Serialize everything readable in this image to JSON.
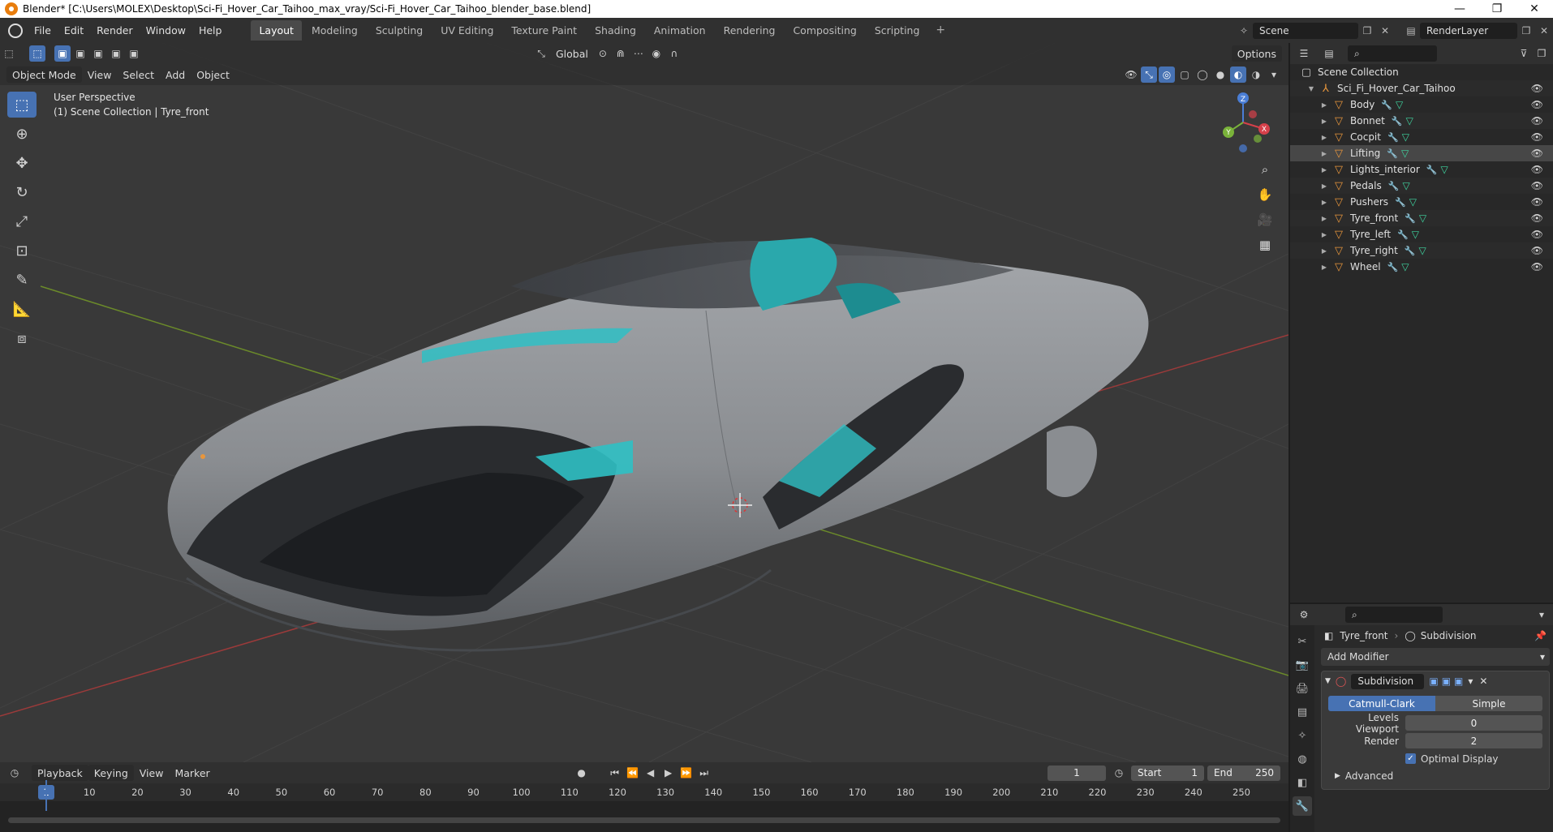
{
  "window": {
    "title": "Blender* [C:\\Users\\MOLEX\\Desktop\\Sci-Fi_Hover_Car_Taihoo_max_vray/Sci-Fi_Hover_Car_Taihoo_blender_base.blend]",
    "minimize": "—",
    "maximize": "❐",
    "close": "✕"
  },
  "menu": [
    "File",
    "Edit",
    "Render",
    "Window",
    "Help"
  ],
  "workspaces": [
    "Layout",
    "Modeling",
    "Sculpting",
    "UV Editing",
    "Texture Paint",
    "Shading",
    "Animation",
    "Rendering",
    "Compositing",
    "Scripting"
  ],
  "active_workspace": "Layout",
  "scene": {
    "name": "Scene",
    "render_layer": "RenderLayer"
  },
  "viewport": {
    "transform_orientation": "Global",
    "options_label": "Options",
    "mode": "Object Mode",
    "menus": [
      "View",
      "Select",
      "Add",
      "Object"
    ],
    "perspective": "User Perspective",
    "collection_info": "(1) Scene Collection | Tyre_front",
    "axes": {
      "x": "X",
      "y": "Y",
      "z": "Z"
    }
  },
  "outliner": {
    "root": "Scene Collection",
    "collection": "Sci_Fi_Hover_Car_Taihoo",
    "objects": [
      {
        "name": "Body",
        "selected": false
      },
      {
        "name": "Bonnet",
        "selected": false
      },
      {
        "name": "Cocpit",
        "selected": false
      },
      {
        "name": "Lifting",
        "selected": true
      },
      {
        "name": "Lights_interior",
        "selected": false
      },
      {
        "name": "Pedals",
        "selected": false
      },
      {
        "name": "Pushers",
        "selected": false
      },
      {
        "name": "Tyre_front",
        "selected": false
      },
      {
        "name": "Tyre_left",
        "selected": false
      },
      {
        "name": "Tyre_right",
        "selected": false
      },
      {
        "name": "Wheel",
        "selected": false
      }
    ]
  },
  "properties": {
    "object": "Tyre_front",
    "modifier_tab": "Subdivision",
    "add_modifier": "Add Modifier",
    "modifier_name": "Subdivision",
    "algo": [
      "Catmull-Clark",
      "Simple"
    ],
    "active_algo": "Catmull-Clark",
    "levels_viewport_label": "Levels Viewport",
    "levels_viewport": "0",
    "render_label": "Render",
    "render_value": "2",
    "optimal_display": "Optimal Display",
    "advanced": "Advanced"
  },
  "timeline": {
    "menus": [
      "Playback",
      "Keying",
      "View",
      "Marker"
    ],
    "current_frame": "1",
    "start_label": "Start",
    "start": "1",
    "end_label": "End",
    "end": "250",
    "ticks": [
      "10",
      "20",
      "30",
      "40",
      "50",
      "60",
      "70",
      "80",
      "90",
      "100",
      "110",
      "120",
      "130",
      "140",
      "150",
      "160",
      "170",
      "180",
      "190",
      "200",
      "210",
      "220",
      "230",
      "240",
      "250"
    ]
  },
  "colors": {
    "accent": "#4772b3",
    "object": "#e8963c",
    "body": "#8d9094",
    "interior": "#2fc0c4"
  }
}
